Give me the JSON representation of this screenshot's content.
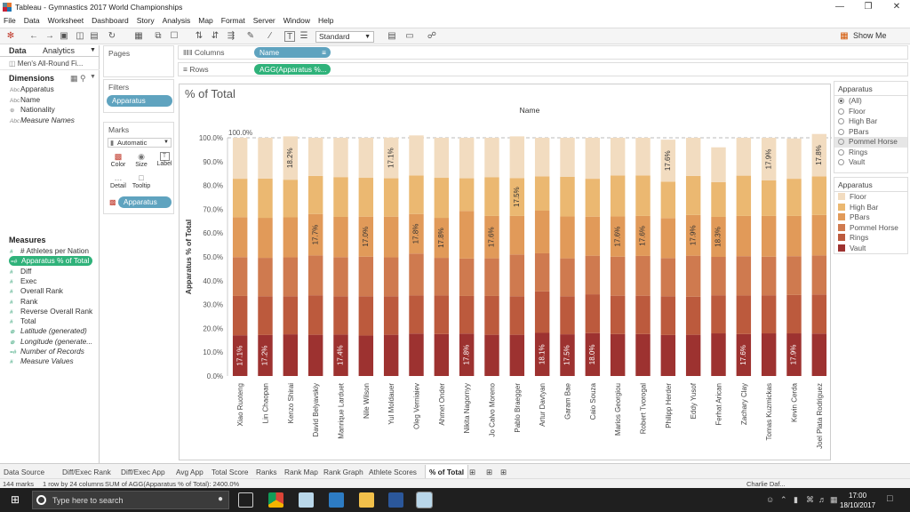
{
  "window": {
    "title": "Tableau - Gymnastics 2017 World Championships"
  },
  "menu": [
    "File",
    "Data",
    "Worksheet",
    "Dashboard",
    "Story",
    "Analysis",
    "Map",
    "Format",
    "Server",
    "Window",
    "Help"
  ],
  "toolbar": {
    "fit": "Standard",
    "show_me": "Show Me"
  },
  "sidebar": {
    "tab_data": "Data",
    "tab_analytics": "Analytics",
    "datasource": "Men's All-Round Fi...",
    "dimensions_header": "Dimensions",
    "dimensions": [
      {
        "icon": "Abc",
        "label": "Apparatus"
      },
      {
        "icon": "Abc",
        "label": "Name"
      },
      {
        "icon": "⊕",
        "label": "Nationality"
      },
      {
        "icon": "Abc",
        "label": "Measure Names"
      }
    ],
    "measures_header": "Measures",
    "measures": [
      {
        "icon": "#",
        "label": "# Athletes per Nation"
      },
      {
        "icon": "=#",
        "label": "Apparatus % of Total"
      },
      {
        "icon": "#",
        "label": "Diff"
      },
      {
        "icon": "#",
        "label": "Exec"
      },
      {
        "icon": "#",
        "label": "Overall Rank"
      },
      {
        "icon": "#",
        "label": "Rank"
      },
      {
        "icon": "#",
        "label": "Reverse Overall Rank"
      },
      {
        "icon": "#",
        "label": "Total"
      },
      {
        "icon": "⊕",
        "label": "Latitude (generated)"
      },
      {
        "icon": "⊕",
        "label": "Longitude (generate..."
      },
      {
        "icon": "=#",
        "label": "Number of Records"
      },
      {
        "icon": "#",
        "label": "Measure Values"
      }
    ]
  },
  "shelves": {
    "pages": "Pages",
    "filters": "Filters",
    "filter_pill": "Apparatus",
    "marks": "Marks",
    "mark_type": "Automatic",
    "mark_buttons": [
      "Color",
      "Size",
      "Label",
      "Detail",
      "Tooltip"
    ],
    "marks_pill": "Apparatus",
    "columns_label": "Columns",
    "columns_pill": "Name",
    "rows_label": "Rows",
    "rows_pill": "AGG(Apparatus %..."
  },
  "view": {
    "title": "% of Total"
  },
  "filter_card": {
    "title": "Apparatus",
    "options": [
      "(All)",
      "Floor",
      "High Bar",
      "PBars",
      "Pommel Horse",
      "Rings",
      "Vault"
    ]
  },
  "color_legend": {
    "title": "Apparatus",
    "items": [
      {
        "label": "Floor",
        "color": "#f2dcc0"
      },
      {
        "label": "High Bar",
        "color": "#ebb871"
      },
      {
        "label": "PBars",
        "color": "#e19a59"
      },
      {
        "label": "Pommel Horse",
        "color": "#cf7a4f"
      },
      {
        "label": "Rings",
        "color": "#bc5a3d"
      },
      {
        "label": "Vault",
        "color": "#9d3230"
      }
    ]
  },
  "chart_data": {
    "type": "bar",
    "stacked": true,
    "xlabel": "Name",
    "ylabel": "Apparatus % of Total",
    "ylim": [
      0,
      100
    ],
    "yticks": [
      "0.0%",
      "10.0%",
      "20.0%",
      "30.0%",
      "40.0%",
      "50.0%",
      "60.0%",
      "70.0%",
      "80.0%",
      "90.0%",
      "100.0%"
    ],
    "reference_label": "100.0%",
    "categories": [
      "Xiao Ruoteng",
      "Lin Chaopan",
      "Kenzo Shirai",
      "David Belyavskiy",
      "Manrique Larduet",
      "Nile Wilson",
      "Yul Moldauer",
      "Oleg Verniaiev",
      "Ahmet Onder",
      "Nikita Nagornyy",
      "Jo Calvo Moreno",
      "Pablo Braegger",
      "Artur Davtyan",
      "Garam Bae",
      "Caio Souza",
      "Marios Georgiou",
      "Robert Tvorogal",
      "Philipp Herder",
      "Eddy Yusof",
      "Ferhat Arican",
      "Zachary Clay",
      "Tomas Kuzmickas",
      "Kevin Cerda",
      "Joel Plata Rodriguez"
    ],
    "series": [
      {
        "name": "Vault",
        "values": [
          17.1,
          17.2,
          17.5,
          17.3,
          17.4,
          17.0,
          17.3,
          17.8,
          17.6,
          17.8,
          17.3,
          17.3,
          18.1,
          17.5,
          18.0,
          17.6,
          17.6,
          17.2,
          17.3,
          17.9,
          17.6,
          17.9,
          17.9,
          17.8
        ]
      },
      {
        "name": "Rings",
        "values": [
          16.5,
          16.3,
          16.0,
          16.6,
          16.1,
          16.5,
          16.2,
          16.0,
          16.2,
          15.8,
          16.3,
          16.2,
          17.4,
          16.0,
          16.3,
          16.1,
          16.1,
          16.3,
          16.0,
          16.0,
          16.2,
          16.0,
          16.1,
          16.4
        ]
      },
      {
        "name": "Pommel Horse",
        "values": [
          16.3,
          16.1,
          16.3,
          16.7,
          16.4,
          16.6,
          16.3,
          17.6,
          15.8,
          15.7,
          15.8,
          17.5,
          16.0,
          15.9,
          16.2,
          16.4,
          16.7,
          16.0,
          17.2,
          16.1,
          16.5,
          16.2,
          16.3,
          16.4
        ]
      },
      {
        "name": "PBars",
        "values": [
          16.8,
          16.8,
          16.8,
          17.4,
          16.9,
          16.8,
          17.1,
          16.6,
          16.8,
          20.0,
          17.8,
          16.2,
          17.9,
          17.6,
          16.4,
          16.9,
          16.8,
          16.8,
          17.1,
          16.8,
          16.9,
          17.1,
          16.9,
          17.0
        ]
      },
      {
        "name": "High Bar",
        "values": [
          16.1,
          16.5,
          15.8,
          16.0,
          16.7,
          16.3,
          16.1,
          16.2,
          16.8,
          13.7,
          16.2,
          15.9,
          14.4,
          16.6,
          15.9,
          17.2,
          17.0,
          15.3,
          16.4,
          14.6,
          16.9,
          14.9,
          15.6,
          16.2
        ]
      },
      {
        "name": "Floor",
        "values": [
          17.2,
          17.1,
          18.2,
          16.0,
          16.5,
          16.8,
          17.1,
          16.8,
          16.8,
          17.0,
          16.6,
          17.5,
          16.2,
          16.4,
          17.2,
          15.8,
          15.8,
          17.6,
          16.0,
          14.6,
          15.9,
          17.9,
          16.9,
          17.8
        ]
      }
    ],
    "labels": [
      {
        "name": "Xiao Ruoteng",
        "series": "Vault",
        "text": "17.1%"
      },
      {
        "name": "Lin Chaopan",
        "series": "Vault",
        "text": "17.2%"
      },
      {
        "name": "Kenzo Shirai",
        "series": "Floor",
        "text": "18.2%"
      },
      {
        "name": "David Belyavskiy",
        "series": "PBars",
        "text": "17.7%"
      },
      {
        "name": "Manrique Larduet",
        "series": "Vault",
        "text": "17.4%"
      },
      {
        "name": "Nile Wilson",
        "series": "PBars",
        "text": "17.0%"
      },
      {
        "name": "Yul Moldauer",
        "series": "Floor",
        "text": "17.1%"
      },
      {
        "name": "Oleg Verniaiev",
        "series": "PBars",
        "text": "17.8%"
      },
      {
        "name": "Ahmet Onder",
        "series": "PBars",
        "text": "17.8%"
      },
      {
        "name": "Nikita Nagornyy",
        "series": "Vault",
        "text": "17.8%"
      },
      {
        "name": "Jo Calvo Moreno",
        "series": "PBars",
        "text": "17.6%"
      },
      {
        "name": "Pablo Braegger",
        "series": "High Bar",
        "text": "17.5%"
      },
      {
        "name": "Artur Davtyan",
        "series": "Vault",
        "text": "18.1%"
      },
      {
        "name": "Garam Bae",
        "series": "Vault",
        "text": "17.5%"
      },
      {
        "name": "Caio Souza",
        "series": "Vault",
        "text": "18.0%"
      },
      {
        "name": "Marios Georgiou",
        "series": "PBars",
        "text": "17.6%"
      },
      {
        "name": "Robert Tvorogal",
        "series": "PBars",
        "text": "17.6%"
      },
      {
        "name": "Philipp Herder",
        "series": "Floor",
        "text": "17.6%"
      },
      {
        "name": "Eddy Yusof",
        "series": "PBars",
        "text": "17.9%"
      },
      {
        "name": "Ferhat Arican",
        "series": "PBars",
        "text": "18.3%"
      },
      {
        "name": "Zachary Clay",
        "series": "Vault",
        "text": "17.6%"
      },
      {
        "name": "Tomas Kuzmickas",
        "series": "Floor",
        "text": "17.9%"
      },
      {
        "name": "Kevin Cerda",
        "series": "Vault",
        "text": "17.9%"
      },
      {
        "name": "Joel Plata Rodriguez",
        "series": "Floor",
        "text": "17.8%"
      }
    ]
  },
  "sheet_tabs": [
    "Data Source",
    "Diff/Exec Rank",
    "Diff/Exec App",
    "Avg App",
    "Total Score",
    "Ranks",
    "Rank Map",
    "Rank Graph",
    "Athlete Scores",
    "% of Total"
  ],
  "status": {
    "marks": "144 marks",
    "rows": "1 row by 24 columns",
    "sum": "SUM of AGG(Apparatus % of Total): 2400.0%",
    "user": "Charlie Daf..."
  },
  "taskbar": {
    "search_placeholder": "Type here to search",
    "time": "17:00",
    "date": "18/10/2017"
  }
}
